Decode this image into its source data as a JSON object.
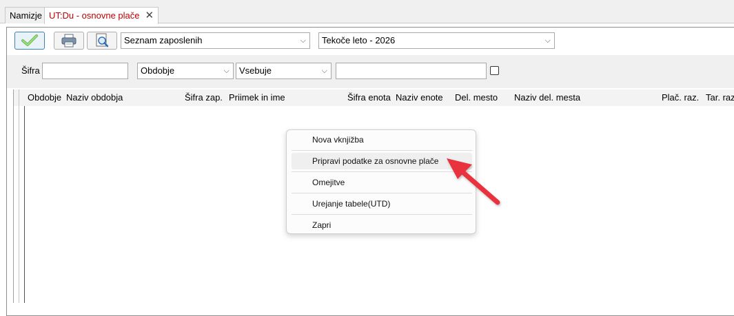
{
  "tabs": [
    {
      "label": "Namizje"
    },
    {
      "label": "UT:Du - osnovne plače",
      "close": "✕"
    }
  ],
  "toolbar": {
    "report_select": "Seznam zaposlenih",
    "year_select": "Tekoče leto - 2026"
  },
  "filter": {
    "code_label": "Šifra",
    "field_select": "Obdobje",
    "operator_select": "Vsebuje"
  },
  "grid": {
    "columns": [
      "Obdobje",
      "Naziv obdobja",
      "Šifra zap.",
      "Priimek in ime",
      "Šifra enota",
      "Naziv enote",
      "Del. mesto",
      "Naziv del. mesta",
      "Plač. raz.",
      "Tar. raz"
    ]
  },
  "context_menu": {
    "items": [
      "Nova vknjižba",
      "Pripravi podatke za osnovne plače",
      "Omejitve",
      "Urejanje tabele(UTD)",
      "Zapri"
    ],
    "highlighted_index": 1
  },
  "annotation": {
    "arrow_color": "#e8323c"
  }
}
